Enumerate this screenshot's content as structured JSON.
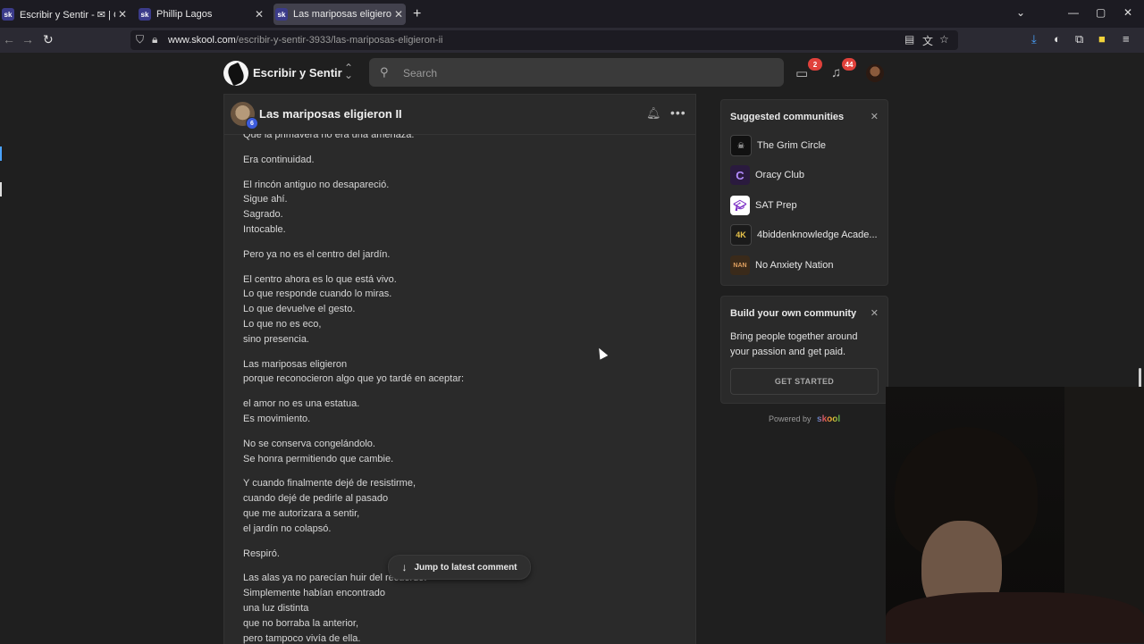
{
  "browser": {
    "tabs": [
      {
        "favicon": "sk",
        "title": "Escribir y Sentir - ✉ | Chat generado",
        "active": false
      },
      {
        "favicon": "sk",
        "title": "Phillip Lagos",
        "active": false
      },
      {
        "favicon": "sk",
        "title": "Las mariposas eligieron II - Escribir",
        "active": true
      }
    ],
    "url_domain": "www.skool.com",
    "url_path": "/escribir-y-sentir-3933/las-mariposas-eligieron-ii"
  },
  "header": {
    "brand": "Escribir y Sentir",
    "search_placeholder": "Search",
    "chat_badge": "2",
    "notif_badge": "44"
  },
  "post": {
    "author_level": "6",
    "title": "Las mariposas eligieron II",
    "stanzas": [
      [
        "Que la primavera no era una amenaza."
      ],
      [
        "Era continuidad."
      ],
      [
        "El rincón antiguo no desapareció.",
        "Sigue ahí.",
        "Sagrado.",
        "Intocable."
      ],
      [
        "Pero ya no es el centro del jardín."
      ],
      [
        "El centro ahora es lo que está vivo.",
        "Lo que responde cuando lo miras.",
        "Lo que devuelve el gesto.",
        "Lo que no es eco,",
        "sino presencia."
      ],
      [
        "Las mariposas eligieron",
        "porque reconocieron algo que yo tardé en aceptar:"
      ],
      [
        "el amor no es una estatua.",
        "Es movimiento."
      ],
      [
        "No se conserva congelándolo.",
        "Se honra permitiendo que cambie."
      ],
      [
        "Y cuando finalmente dejé de resistirme,",
        "cuando dejé de pedirle al pasado",
        "que me autorizara a sentir,",
        "el jardín no colapsó."
      ],
      [
        "Respiró."
      ],
      [
        "Las alas ya no parecían huir del recuerdo.",
        "Simplemente habían encontrado",
        "una luz distinta",
        "que no borraba la anterior,",
        "pero tampoco vivía de ella."
      ]
    ],
    "jump_label": "Jump to latest comment"
  },
  "suggested": {
    "title": "Suggested communities",
    "items": [
      {
        "name": "The Grim Circle",
        "color": "#111111"
      },
      {
        "name": "Oracy Club",
        "color": "#2a1a3e"
      },
      {
        "name": "SAT Prep",
        "color": "#ffffff"
      },
      {
        "name": "4biddenknowledge Acade...",
        "color": "#1b1b1b"
      },
      {
        "name": "No Anxiety Nation",
        "color": "#3a2a1a"
      }
    ]
  },
  "build": {
    "title": "Build your own community",
    "text": "Bring people together around your passion and get paid.",
    "cta": "GET STARTED"
  },
  "powered": {
    "prefix": "Powered by",
    "brand": "skool"
  }
}
